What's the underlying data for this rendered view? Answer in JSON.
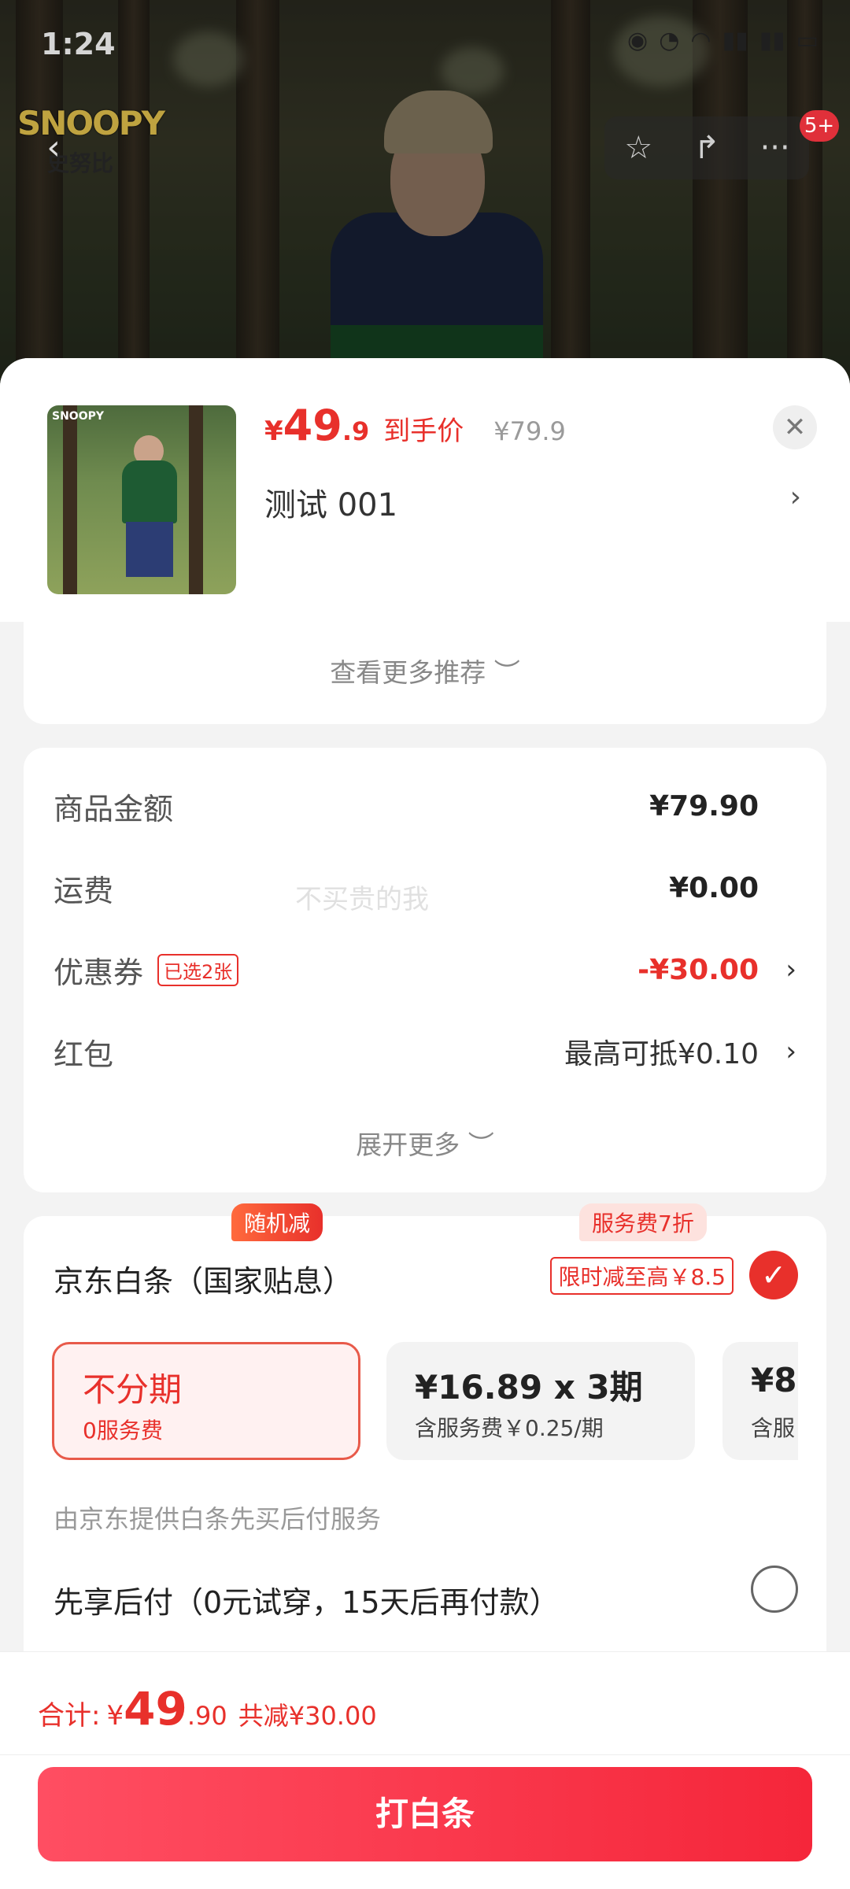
{
  "status_bar": {
    "time": "1:24"
  },
  "brand": {
    "name": "SNOOPY",
    "sub": "史努比"
  },
  "top_bar": {
    "cart_badge": "5+"
  },
  "product": {
    "price_symbol": "¥",
    "price_int": "49",
    "price_dec": ".9",
    "price_tag": "到手价",
    "original_price": "¥79.9",
    "name": "测试  001"
  },
  "recommend": {
    "label": "查看更多推荐 ︶"
  },
  "fees": {
    "goods_label": "商品金额",
    "goods_value": "¥79.90",
    "shipping_label": "运费",
    "shipping_value": "¥0.00",
    "coupon_label": "优惠券",
    "coupon_tag": "已选2张",
    "coupon_value": "-¥30.00",
    "redpacket_label": "红包",
    "redpacket_value": "最高可抵¥0.10",
    "expand_label": "展开更多 ︶",
    "watermark": "不买贵的我"
  },
  "payment": {
    "title": "京东白条（国家贴息）",
    "limit_tag": "限时减至高￥8.5",
    "plans": [
      {
        "big": "不分期",
        "small": "0服务费",
        "badge": "随机减"
      },
      {
        "big": "¥16.89 x 3期",
        "small": "含服务费￥0.25/期",
        "badge": "服务费7折"
      },
      {
        "big": "¥8.",
        "small": "含服"
      }
    ],
    "note": "由京东提供白条先买后付服务",
    "bnpl_label": "先享后付（0元试穿，15天后再付款）"
  },
  "total": {
    "label": "合计:",
    "symbol": "¥",
    "int": "49",
    "dec": ".90",
    "cut": "共减¥30.00"
  },
  "pay_button": {
    "label": "打白条"
  }
}
